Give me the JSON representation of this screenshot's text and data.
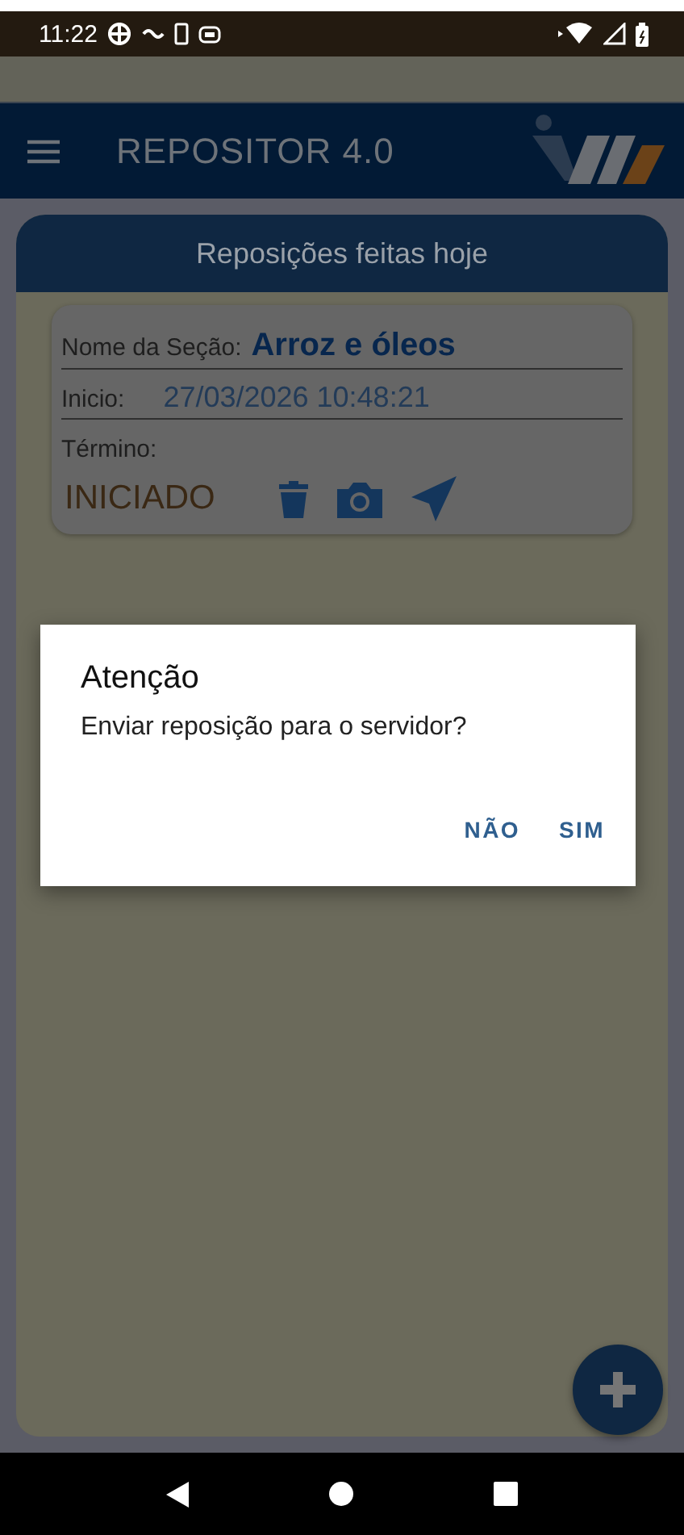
{
  "status_bar": {
    "time": "11:22"
  },
  "app_bar": {
    "title": "REPOSITOR 4.0"
  },
  "panel": {
    "title": "Reposições feitas hoje"
  },
  "records": [
    {
      "section_label": "Nome da Seção:",
      "section": "Arroz e óleos",
      "start_label": "Inicio:",
      "start": "27/03/2026 10:48:21",
      "end_label": "Término:",
      "status": "INICIADO"
    }
  ],
  "dialog": {
    "title": "Atenção",
    "message": "Enviar reposição para o servidor?",
    "buttons": [
      "NÃO",
      "SIM"
    ]
  }
}
